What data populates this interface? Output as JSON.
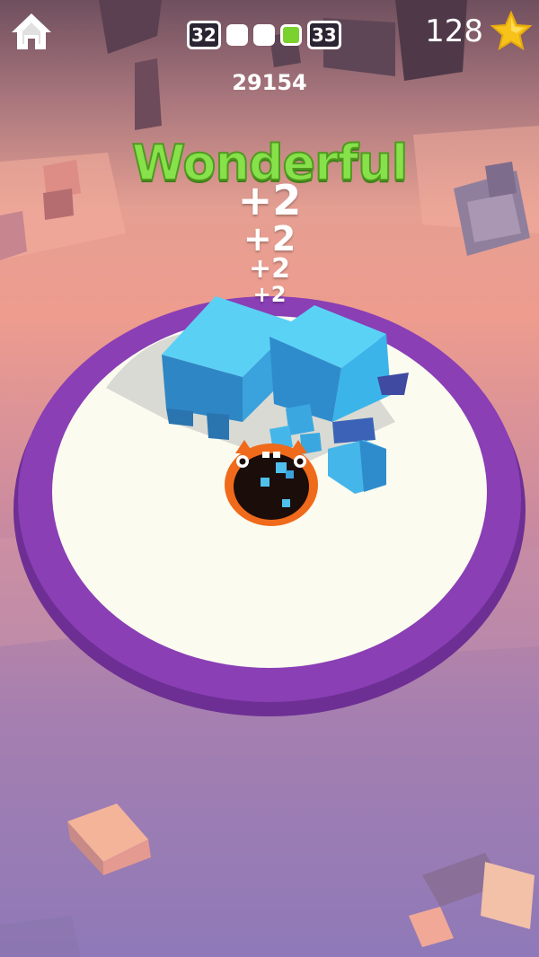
{
  "hud": {
    "level_current": "32",
    "level_next": "33",
    "stage_progress": [
      false,
      false,
      true
    ],
    "score": "29154",
    "stars": "128"
  },
  "popup": {
    "praise": "Wonderful",
    "points": [
      "+2",
      "+2",
      "+2",
      "+2"
    ]
  },
  "colors": {
    "arena_rim": "#8a3fb5",
    "arena_floor": "#fbfbf0",
    "hole_rim": "#f06a1b",
    "block": "#3fa8dd",
    "praise_text": "#86e14a",
    "star": "#f7c31a"
  },
  "icons": {
    "home": "home-icon",
    "star": "star-icon"
  }
}
